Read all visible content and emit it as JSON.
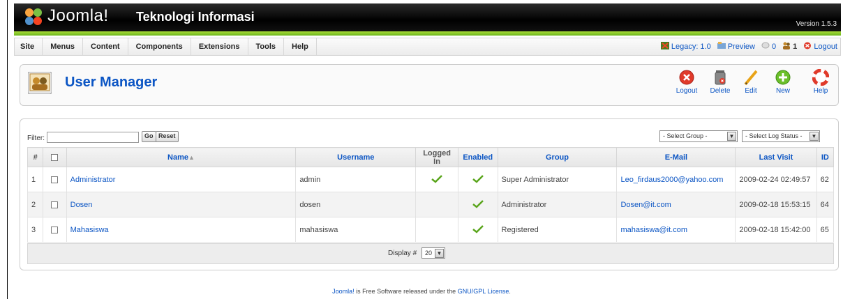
{
  "header": {
    "brand": "Joomla!",
    "site_title": "Teknologi Informasi",
    "version": "Version 1.5.3"
  },
  "menu": {
    "items": [
      "Site",
      "Menus",
      "Content",
      "Components",
      "Extensions",
      "Tools",
      "Help"
    ]
  },
  "status": {
    "legacy": "Legacy: 1.0",
    "preview": "Preview",
    "messages": "0",
    "users": "1",
    "logout": "Logout"
  },
  "toolbar": {
    "title": "User Manager",
    "buttons": [
      {
        "label": "Logout",
        "icon": "logout-icon"
      },
      {
        "label": "Delete",
        "icon": "trash-icon"
      },
      {
        "label": "Edit",
        "icon": "pencil-icon"
      },
      {
        "label": "New",
        "icon": "plus-icon"
      },
      {
        "label": "Help",
        "icon": "lifebuoy-icon"
      }
    ]
  },
  "filter": {
    "label": "Filter:",
    "value": "",
    "go_label": "Go",
    "reset_label": "Reset",
    "group_select": "- Select Group -",
    "log_status_select": "- Select Log Status -"
  },
  "table": {
    "headers": {
      "num": "#",
      "name": "Name",
      "username": "Username",
      "logged_in": "Logged In",
      "enabled": "Enabled",
      "group": "Group",
      "email": "E-Mail",
      "last_visit": "Last Visit",
      "id": "ID"
    },
    "rows": [
      {
        "num": "1",
        "name": "Administrator",
        "username": "admin",
        "logged_in": true,
        "enabled": true,
        "group": "Super Administrator",
        "email": "Leo_firdaus2000@yahoo.com",
        "last_visit": "2009-02-24 02:49:57",
        "id": "62"
      },
      {
        "num": "2",
        "name": "Dosen",
        "username": "dosen",
        "logged_in": false,
        "enabled": true,
        "group": "Administrator",
        "email": "Dosen@it.com",
        "last_visit": "2009-02-18 15:53:15",
        "id": "64"
      },
      {
        "num": "3",
        "name": "Mahasiswa",
        "username": "mahasiswa",
        "logged_in": false,
        "enabled": true,
        "group": "Registered",
        "email": "mahasiswa@it.com",
        "last_visit": "2009-02-18 15:42:00",
        "id": "65"
      }
    ]
  },
  "pagination": {
    "display_label": "Display #",
    "display_value": "20"
  },
  "footer": {
    "joomla_link": "Joomla!",
    "text": " is Free Software released under the ",
    "license_link": "GNU/GPL License",
    "period": "."
  },
  "colors": {
    "link": "#0b55c4",
    "accent_green": "#6bb51c",
    "header_bg": "#000000"
  }
}
